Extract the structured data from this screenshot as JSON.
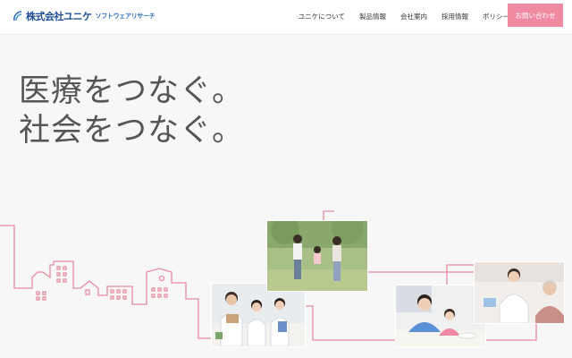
{
  "header": {
    "logo": {
      "main": "株式会社ユニケ",
      "sub": "ソフトウェアリサーチ"
    },
    "nav": [
      {
        "label": "ユニケについて"
      },
      {
        "label": "製品情報"
      },
      {
        "label": "会社案内"
      },
      {
        "label": "採用情報"
      },
      {
        "label": "ポリシー"
      }
    ],
    "contact_label": "お問い合わせ"
  },
  "hero": {
    "lines": [
      "医療をつなぐ。",
      "社会をつなぐ。"
    ]
  },
  "colors": {
    "accent_pink": "#ef8aa0",
    "line_pink": "#e98aa0",
    "logo_blue": "#1d4f9a",
    "text_gray": "#555555"
  }
}
